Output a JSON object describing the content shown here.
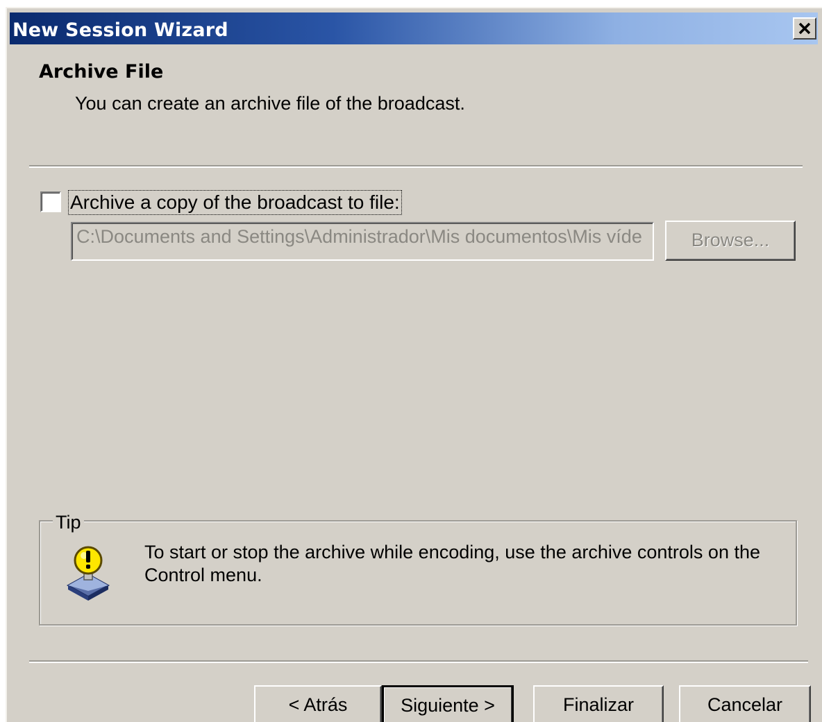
{
  "window": {
    "title": "New Session Wizard"
  },
  "header": {
    "title": "Archive File",
    "subtitle": "You can create an archive file of the broadcast."
  },
  "archive": {
    "checkbox_label": "Archive a copy of the broadcast to file:",
    "checked": false,
    "path_value": "C:\\Documents and Settings\\Administrador\\Mis documentos\\Mis víde",
    "browse_label": "Browse..."
  },
  "tip": {
    "legend": "Tip",
    "text": "To start or stop the archive while encoding, use the archive controls on the Control menu.",
    "icon": "warning-bulb-icon"
  },
  "footer": {
    "back_label": "< Atrás",
    "next_label": "Siguiente >",
    "finish_label": "Finalizar",
    "cancel_label": "Cancelar"
  },
  "colors": {
    "title_gradient_start": "#0a2a6e",
    "title_gradient_end": "#a8c6f0",
    "dialog_face": "#d4d0c8",
    "disabled_text": "#8a8882"
  }
}
